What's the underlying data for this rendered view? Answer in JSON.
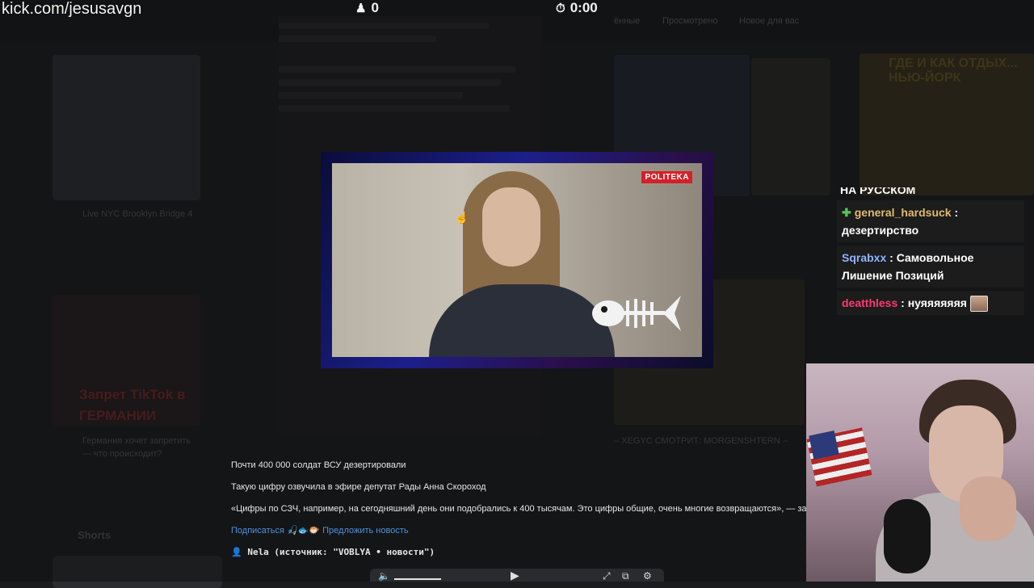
{
  "stream_overlay": {
    "url": "kick.com/jesusavgn",
    "viewers_icon": "people-icon",
    "viewers": "0",
    "timer_icon": "stopwatch-icon",
    "timer": "0:00"
  },
  "background_page": {
    "tab_watched": "ённые",
    "tab_viewed": "Просмотрено",
    "tab_new": "Новое для вас",
    "card1_title": "Live NYC Brooklyn Bridge 4",
    "card2_title": "Германия хочет запретить",
    "card2_sub": "— что происходит?",
    "card3_banner": "Запрет TikTok в ГЕРМАНИИ",
    "card4_title": "– XEGYC СМОТРИТ: MORGENSHTERN –",
    "right_thumb_text": "ГДЕ И КАК ОТДЫХ... НЬЮ-ЙОРК",
    "shorts_label": "Shorts"
  },
  "video": {
    "brand_badge": "POLITEKA",
    "watermark_icon": "fish-skeleton-icon"
  },
  "chat": {
    "header": "НА РУССКОМ",
    "messages": [
      {
        "badge_icon": "verified-icon",
        "user": "general_hardsuck",
        "user_color": "#e2b96f",
        "text": ": дезертирство"
      },
      {
        "user": "Sqrabxx",
        "user_color": "#8fb3ff",
        "text": ": Самовольное Лишение Позиций"
      },
      {
        "user": "deatthless",
        "user_color": "#ff3a6e",
        "text": ": нуяяяяяяя",
        "emote": "emote-icon"
      }
    ]
  },
  "post": {
    "title": "Почти 400 000 солдат ВСУ дезертировали",
    "line2": "Такую цифру озвучила в эфире депутат Рады Анна Скороход",
    "line3": "«Цифры по СЗЧ, например, на сегодняшний день они подобрались к 400 тысячам. Это цифры общие, очень многие возвращаются», — заявила она",
    "subscribe_link": "Подписаться",
    "emoji_row": "🎣🐟🐡",
    "suggest_link": "Предложить новость",
    "author": "👤 Nela (источник: \"VOBLYA • новости\")"
  },
  "player": {
    "volume_icon": "volume-icon",
    "volume_level": 0.8,
    "play_icon": "play-icon",
    "fullscreen_icon": "fullscreen-icon",
    "pip_icon": "pip-icon",
    "settings_icon": "settings-icon"
  },
  "colors": {
    "link": "#4e92db",
    "politeka_red": "#d4202a",
    "chat_bg": "#1e1e1e"
  }
}
